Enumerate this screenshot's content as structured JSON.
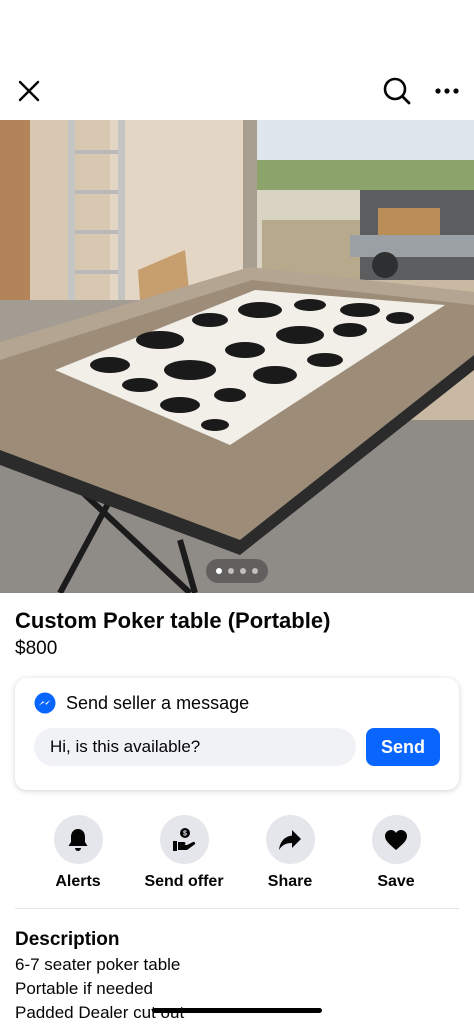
{
  "listing": {
    "title": "Custom Poker table (Portable)",
    "price": "$800",
    "photo_count": 4,
    "active_photo_index": 0
  },
  "toolbar": {
    "close_icon": "close-icon",
    "search_icon": "search-icon",
    "more_icon": "more-horizontal-icon"
  },
  "message": {
    "header": "Send seller a message",
    "input_value": "Hi, is this available?",
    "send_label": "Send",
    "accent_color": "#0866ff"
  },
  "actions": [
    {
      "label": "Alerts",
      "icon": "bell-icon"
    },
    {
      "label": "Send offer",
      "icon": "send-offer-icon"
    },
    {
      "label": "Share",
      "icon": "share-icon"
    },
    {
      "label": "Save",
      "icon": "heart-icon"
    }
  ],
  "description": {
    "title": "Description",
    "lines": [
      "6-7 seater poker table",
      "Portable if needed",
      "Padded Dealer cut out"
    ]
  }
}
